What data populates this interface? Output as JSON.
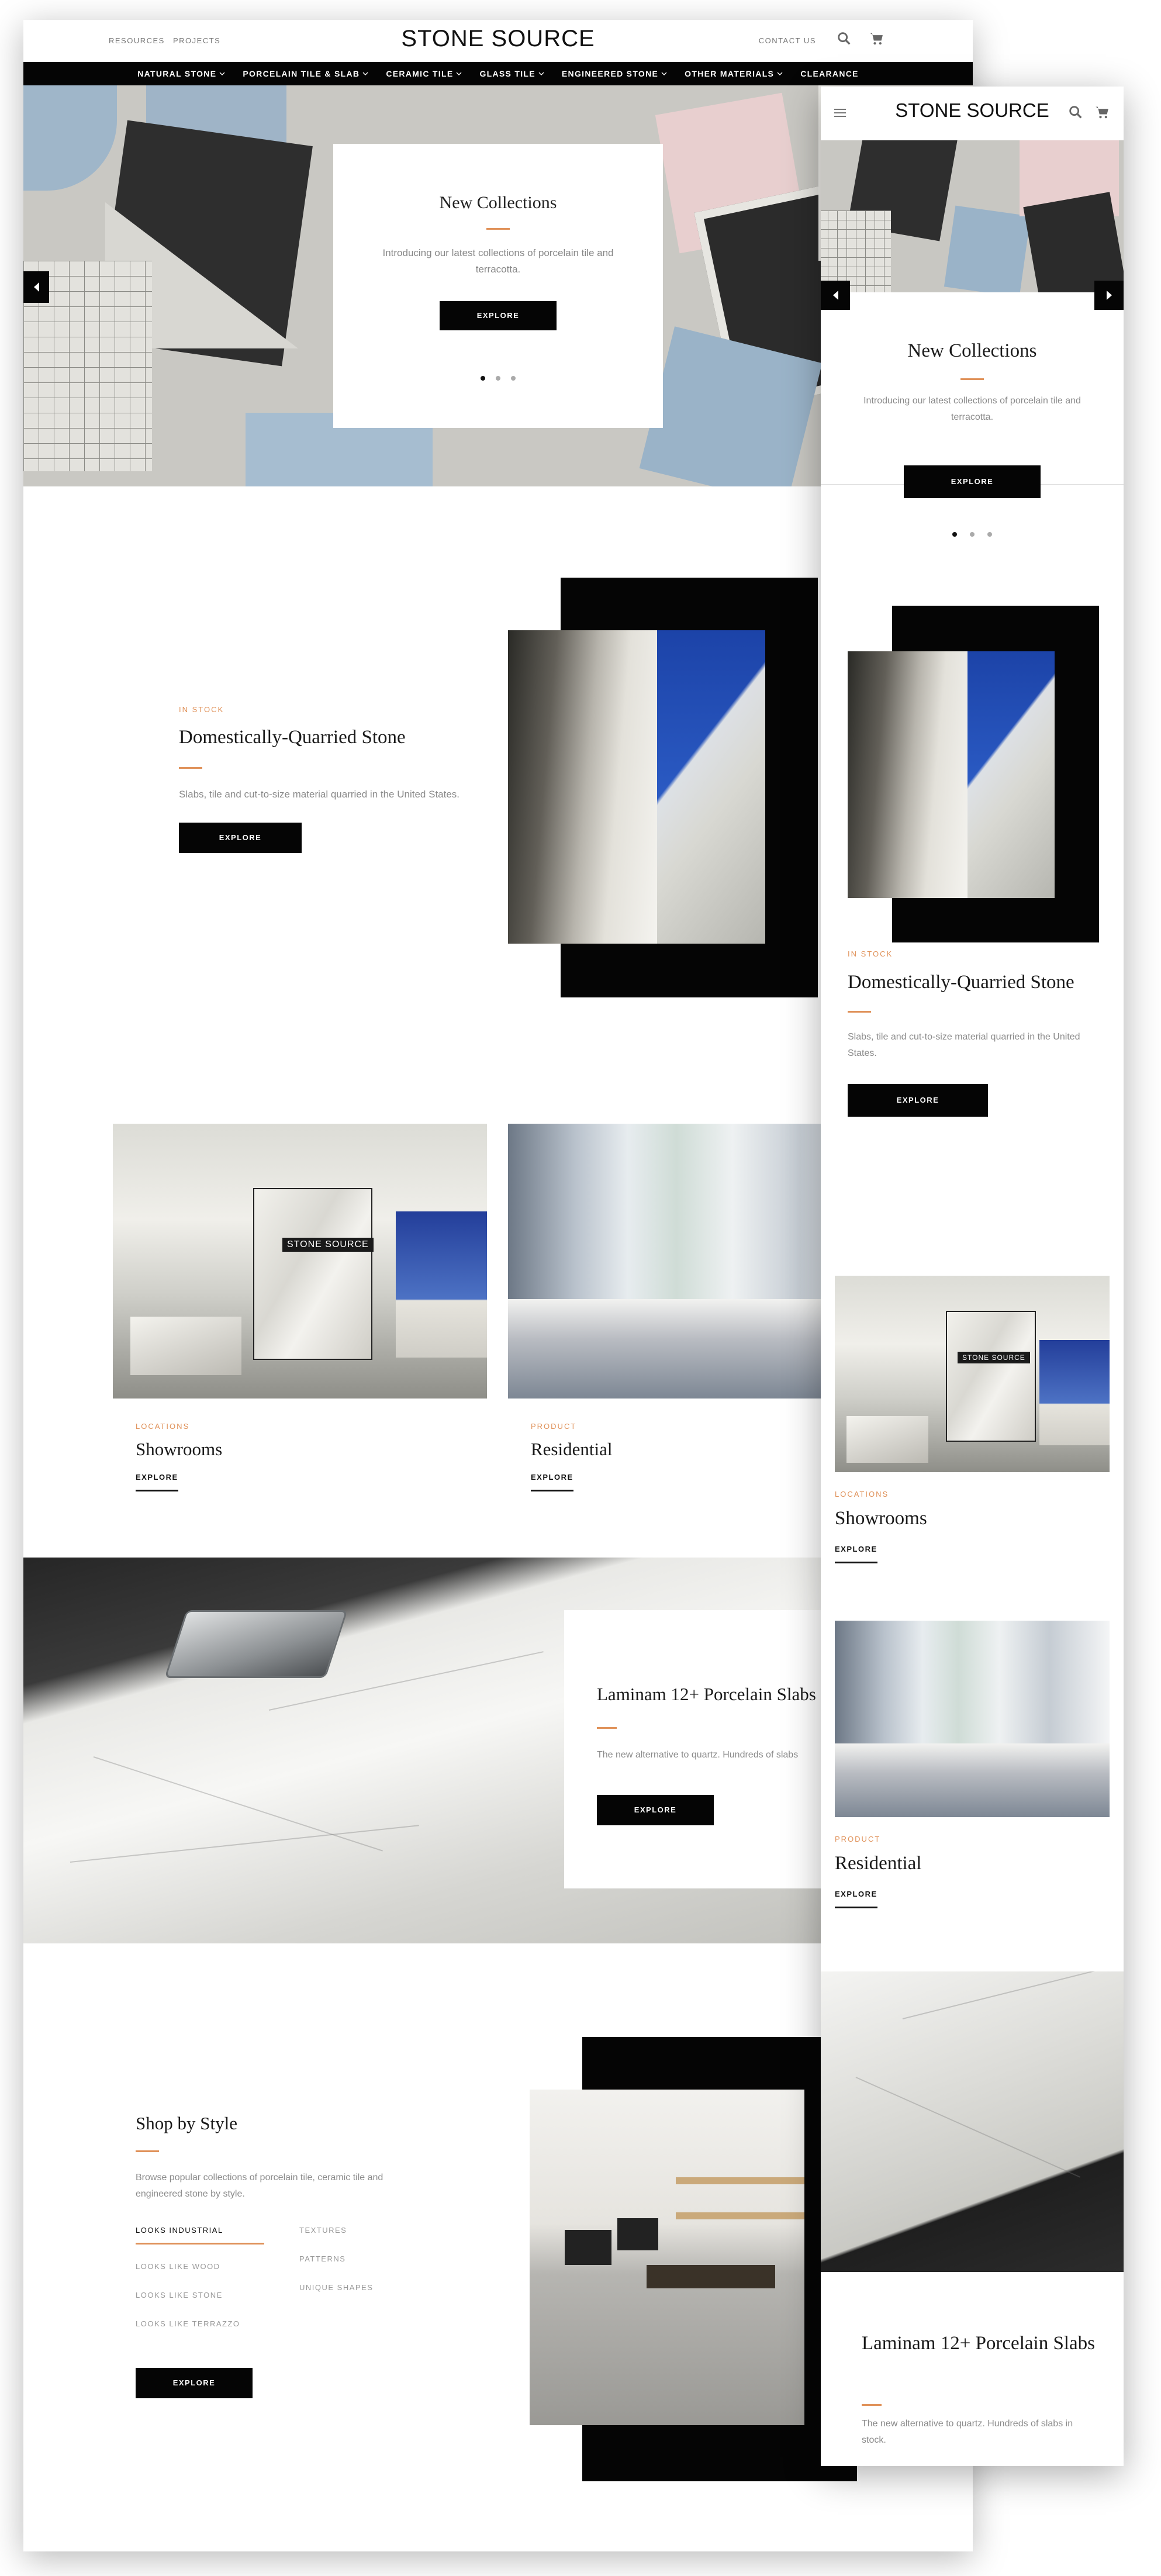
{
  "desktop": {
    "header": {
      "util_left": [
        "RESOURCES",
        "PROJECTS"
      ],
      "logo": "STONE SOURCE",
      "contact": "CONTACT US",
      "icons": [
        "search-icon",
        "cart-icon"
      ]
    },
    "nav": [
      "NATURAL STONE",
      "PORCELAIN TILE & SLAB",
      "CERAMIC TILE",
      "GLASS TILE",
      "ENGINEERED STONE",
      "OTHER MATERIALS",
      "CLEARANCE"
    ],
    "hero": {
      "title": "New Collections",
      "subtitle": "Introducing our latest collections of porcelain tile and terracotta.",
      "button": "EXPLORE",
      "slide_count": 3,
      "active_slide": 1
    },
    "domestic": {
      "eyebrow": "IN STOCK",
      "title": "Domestically-Quarried Stone",
      "body": "Slabs, tile and cut-to-size material quarried in the United States.",
      "button": "EXPLORE"
    },
    "cards": [
      {
        "eyebrow": "LOCATIONS",
        "title": "Showrooms",
        "link": "EXPLORE",
        "sign": "STONE SOURCE"
      },
      {
        "eyebrow": "PRODUCT",
        "title": "Residential",
        "link": "EXPLORE"
      }
    ],
    "laminam": {
      "title": "Laminam 12+ Porcelain Slabs",
      "body": "The new alternative to quartz. Hundreds of slabs",
      "button": "EXPLORE"
    },
    "style": {
      "title": "Shop by Style",
      "body": "Browse popular collections of porcelain tile, ceramic tile and engineered stone by style.",
      "col1": [
        "LOOKS INDUSTRIAL",
        "LOOKS LIKE WOOD",
        "LOOKS LIKE STONE",
        "LOOKS LIKE TERRAZZO"
      ],
      "col2": [
        "TEXTURES",
        "PATTERNS",
        "UNIQUE SHAPES"
      ],
      "active": "LOOKS INDUSTRIAL",
      "button": "EXPLORE"
    }
  },
  "mobile": {
    "logo": "STONE SOURCE",
    "icons": [
      "menu-icon",
      "search-icon",
      "cart-icon"
    ],
    "hero": {
      "title": "New Collections",
      "subtitle": "Introducing our latest collections of porcelain tile and terracotta.",
      "button": "EXPLORE",
      "slide_count": 3,
      "active_slide": 1
    },
    "domestic": {
      "eyebrow": "IN STOCK",
      "title": "Domestically-Quarried Stone",
      "body": "Slabs, tile and cut-to-size material quarried in the United States.",
      "button": "EXPLORE"
    },
    "cards": [
      {
        "eyebrow": "LOCATIONS",
        "title": "Showrooms",
        "link": "EXPLORE",
        "sign": "STONE SOURCE"
      },
      {
        "eyebrow": "PRODUCT",
        "title": "Residential",
        "link": "EXPLORE"
      }
    ],
    "laminam": {
      "title": "Laminam 12+ Porcelain Slabs",
      "body": "The new alternative to quartz. Hundreds of slabs in stock."
    }
  },
  "colors": {
    "accent": "#e0925a",
    "black": "#050505",
    "text_gray": "#8a8a8a"
  }
}
